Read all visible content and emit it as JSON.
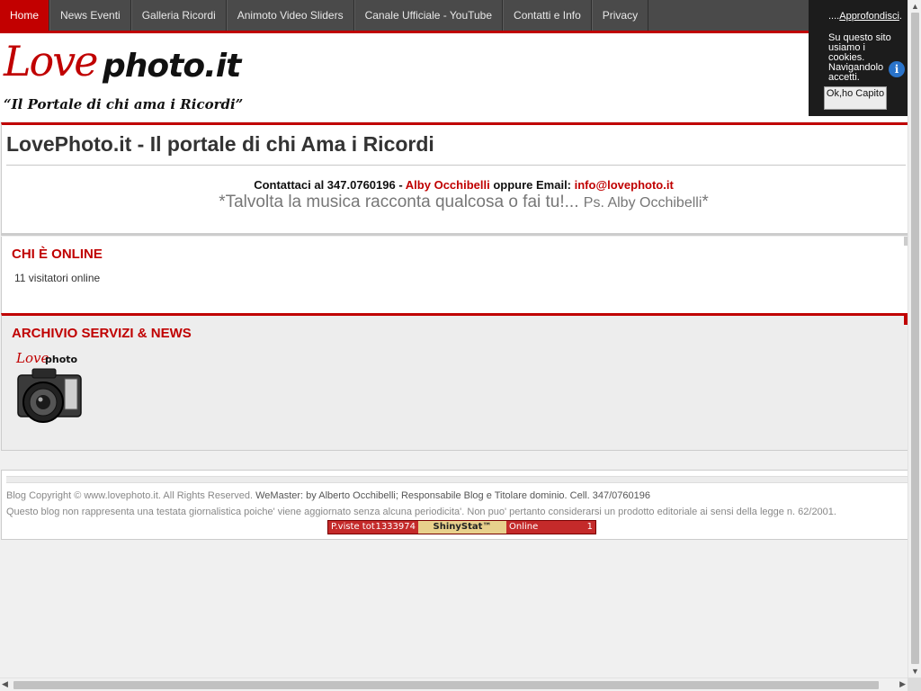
{
  "nav": {
    "items": [
      {
        "label": "Home",
        "active": true
      },
      {
        "label": "News Eventi"
      },
      {
        "label": "Galleria Ricordi"
      },
      {
        "label": "Animoto Video Sliders"
      },
      {
        "label": "Canale Ufficiale - YouTube"
      },
      {
        "label": "Contatti e Info"
      },
      {
        "label": "Privacy"
      }
    ]
  },
  "logo": {
    "love": "Love",
    "photo": "photo.it",
    "tagline": "“Il Portale di chi ama i Ricordi”"
  },
  "main": {
    "title": "LovePhoto.it - Il portale di chi Ama i Ricordi",
    "contact_prefix": "Contattaci al 347.0760196 - ",
    "contact_name": "Alby Occhibelli",
    "contact_mid": " oppure Email: ",
    "contact_email": "info@lovephoto.it",
    "quote": "*Talvolta la musica racconta qualcosa o fai tu!... ",
    "quote_ps": "Ps. Alby Occhibelli",
    "quote_end": "*"
  },
  "online": {
    "title": "CHI È ONLINE",
    "count": "11 visitatori online"
  },
  "archive": {
    "title": "ARCHIVIO SERVIZI & NEWS",
    "logo_love": "Love",
    "logo_photo": "photo"
  },
  "footer": {
    "line1_a": "Blog Copyright © www.lovephoto.it. All Rights Reserved. ",
    "line1_b": "WeMaster: by ",
    "line1_c": "Alberto Occhibelli; Responsabile Blog e Titolare dominio. Cell. 347/0760196",
    "line2": "Questo blog non rappresenta una testata giornalistica poiche' viene aggiornato senza alcuna periodicita'. Non puo' pertanto considerarsi un prodotto editoriale ai sensi della legge n. 62/2001.",
    "stat_views_label": "P.viste tot",
    "stat_views_value": "1333974",
    "stat_brand": "ShinyStat™",
    "stat_online_label": "Online",
    "stat_online_value": "1"
  },
  "cookie": {
    "link_prefix": "....",
    "link": "Approfondisci",
    "link_suffix": ".",
    "text": "Su questo sito usiamo i cookies. Navigandolo accetti.",
    "button": "Ok,ho Capito",
    "info_icon": "i"
  },
  "colors": {
    "accent": "#c00000",
    "nav_bg": "#4a4a4a",
    "cookie_bg": "#1c1c1c",
    "info_blue": "#2a73c9"
  }
}
